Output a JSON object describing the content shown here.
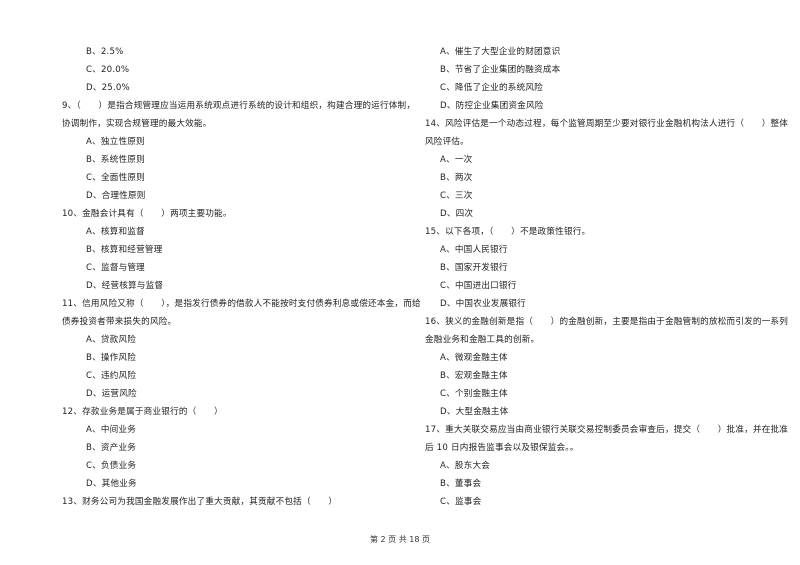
{
  "left_column": [
    {
      "type": "opt",
      "text": "B、2.5%"
    },
    {
      "type": "opt",
      "text": "C、20.0%"
    },
    {
      "type": "opt",
      "text": "D、25.0%"
    },
    {
      "type": "q",
      "text": "9、（　　）是指合规管理应当运用系统观点进行系统的设计和组织，构建合理的运行体制，"
    },
    {
      "type": "q",
      "text": "协调制作，实现合规管理的最大效能。"
    },
    {
      "type": "opt",
      "text": "A、独立性原则"
    },
    {
      "type": "opt",
      "text": "B、系统性原则"
    },
    {
      "type": "opt",
      "text": "C、全面性原则"
    },
    {
      "type": "opt",
      "text": "D、合理性原则"
    },
    {
      "type": "q",
      "text": "10、金融会计具有（　　）两项主要功能。"
    },
    {
      "type": "opt",
      "text": "A、核算和监督"
    },
    {
      "type": "opt",
      "text": "B、核算和经营管理"
    },
    {
      "type": "opt",
      "text": "C、监督与管理"
    },
    {
      "type": "opt",
      "text": "D、经营核算与监督"
    },
    {
      "type": "q",
      "text": "11、信用风险又称（　　），是指发行债券的借款人不能按时支付债券利息或偿还本金，而给"
    },
    {
      "type": "q",
      "text": "债券投资者带来损失的风险。"
    },
    {
      "type": "opt",
      "text": "A、贷款风险"
    },
    {
      "type": "opt",
      "text": "B、操作风险"
    },
    {
      "type": "opt",
      "text": "C、违约风险"
    },
    {
      "type": "opt",
      "text": "D、运营风险"
    },
    {
      "type": "q",
      "text": "12、存款业务是属于商业银行的（　　）"
    },
    {
      "type": "opt",
      "text": "A、中间业务"
    },
    {
      "type": "opt",
      "text": "B、资产业务"
    },
    {
      "type": "opt",
      "text": "C、负债业务"
    },
    {
      "type": "opt",
      "text": "D、其他业务"
    },
    {
      "type": "q",
      "text": "13、财务公司为我国金融发展作出了重大贡献，其贡献不包括（　　）"
    }
  ],
  "right_column": [
    {
      "type": "opt",
      "text": "A、催生了大型企业的财团意识"
    },
    {
      "type": "opt",
      "text": "B、节省了企业集团的融资成本"
    },
    {
      "type": "opt",
      "text": "C、降低了企业的系统风险"
    },
    {
      "type": "opt",
      "text": "D、防控企业集团资金风险"
    },
    {
      "type": "q",
      "text": "14、风险评估是一个动态过程，每个监管周期至少要对银行业金融机构法人进行（　　）整体"
    },
    {
      "type": "q",
      "text": "风险评估。"
    },
    {
      "type": "opt",
      "text": "A、一次"
    },
    {
      "type": "opt",
      "text": "B、两次"
    },
    {
      "type": "opt",
      "text": "C、三次"
    },
    {
      "type": "opt",
      "text": "D、四次"
    },
    {
      "type": "q",
      "text": "15、以下各项，（　　）不是政策性银行。"
    },
    {
      "type": "opt",
      "text": "A、中国人民银行"
    },
    {
      "type": "opt",
      "text": "B、国家开发银行"
    },
    {
      "type": "opt",
      "text": "C、中国进出口银行"
    },
    {
      "type": "opt",
      "text": "D、中国农业发展银行"
    },
    {
      "type": "q",
      "text": "16、狭义的金融创新是指（　　）的金融创新，主要是指由于金融管制的放松而引发的一系列"
    },
    {
      "type": "q",
      "text": "金融业务和金融工具的创新。"
    },
    {
      "type": "opt",
      "text": "A、微观金融主体"
    },
    {
      "type": "opt",
      "text": "B、宏观金融主体"
    },
    {
      "type": "opt",
      "text": "C、个别金融主体"
    },
    {
      "type": "opt",
      "text": "D、大型金融主体"
    },
    {
      "type": "q",
      "text": "17、重大关联交易应当由商业银行关联交易控制委员会审查后，提交（　　）批准，并在批准"
    },
    {
      "type": "q",
      "text": "后 10 日内报告监事会以及银保监会。。"
    },
    {
      "type": "opt",
      "text": "A、股东大会"
    },
    {
      "type": "opt",
      "text": "B、董事会"
    },
    {
      "type": "opt",
      "text": "C、监事会"
    }
  ],
  "footer": {
    "page_label": "第 2 页 共 18 页"
  }
}
